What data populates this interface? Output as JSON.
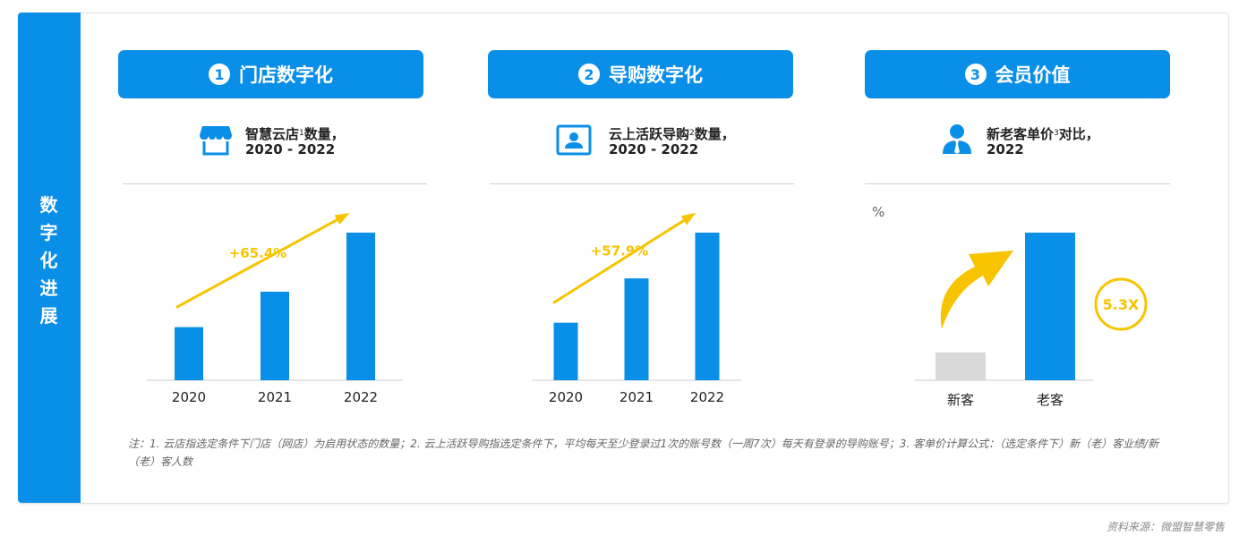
{
  "side_label": "数字化进展",
  "panels": [
    {
      "number": "1",
      "title": "门店数字化",
      "subtitle_pre": "智慧云店",
      "subtitle_sup": "1",
      "subtitle_post": "数量，",
      "subtitle_line2": "2020 - 2022"
    },
    {
      "number": "2",
      "title": "导购数字化",
      "subtitle_pre": "云上活跃导购",
      "subtitle_sup": "2",
      "subtitle_post": "数量，",
      "subtitle_line2": "2020 - 2022"
    },
    {
      "number": "3",
      "title": "会员价值",
      "subtitle_pre": "新老客单价",
      "subtitle_sup": "3",
      "subtitle_post": "对比，",
      "subtitle_line2": "2022"
    }
  ],
  "chart_data": [
    {
      "type": "bar",
      "categories": [
        "2020",
        "2021",
        "2022"
      ],
      "values": [
        36,
        60,
        100
      ],
      "ylim": [
        0,
        100
      ],
      "annotation": "+65.4%",
      "bar_color": "#0A8FE8",
      "accent_color": "#F8C400"
    },
    {
      "type": "bar",
      "categories": [
        "2020",
        "2021",
        "2022"
      ],
      "values": [
        39,
        69,
        100
      ],
      "ylim": [
        0,
        100
      ],
      "annotation": "+57.9%",
      "bar_color": "#0A8FE8",
      "accent_color": "#F8C400"
    },
    {
      "type": "bar",
      "categories": [
        "新客",
        "老客"
      ],
      "values": [
        1,
        5.3
      ],
      "ylim": [
        0,
        5.3
      ],
      "unit": "%",
      "annotation": "5.3X",
      "bar_colors": [
        "#D9D9D9",
        "#0A8FE8"
      ],
      "accent_color": "#F8C400"
    }
  ],
  "note": "注：1. 云店指选定条件下门店（网店）为启用状态的数量；2. 云上活跃导购指选定条件下，平均每天至少登录过1次的账号数（一周7次）每天有登录的导购账号；3. 客单价计算公式：（选定条件下）新（老）客业绩/新（老）客人数",
  "source": "资料来源：微盟智慧零售",
  "icons": [
    "store-icon",
    "id-card-icon",
    "user-icon"
  ],
  "colors": {
    "primary": "#0A8FE8",
    "accent": "#F8C400",
    "muted": "#D9D9D9"
  }
}
